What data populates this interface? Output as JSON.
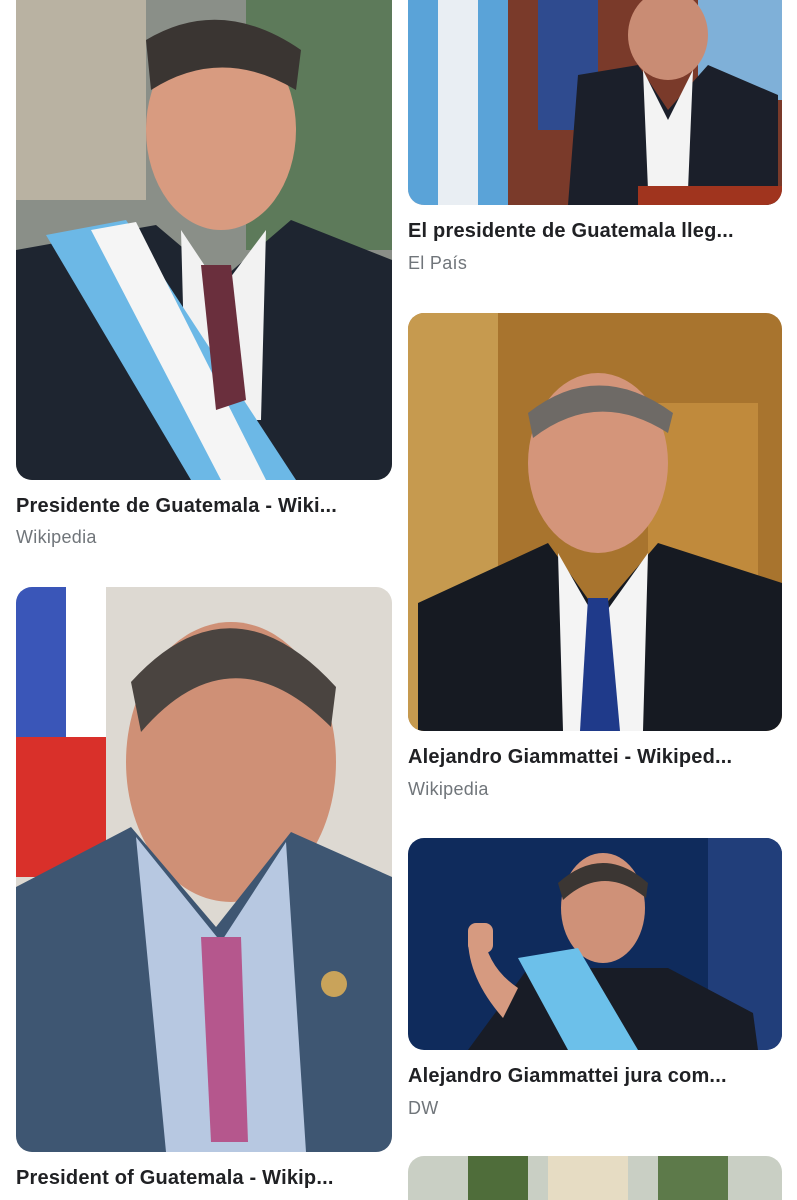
{
  "results": [
    {
      "title": "Presidente de Guatemala - Wiki...",
      "source": "Wikipedia",
      "image": "man-with-presidential-sash-photo"
    },
    {
      "title": "El presidente de Guatemala lleg...",
      "source": "El País",
      "image": "man-speaking-at-podium-with-flags-photo"
    },
    {
      "title": "Alejandro Giammattei - Wikiped...",
      "source": "Wikipedia",
      "image": "official-portrait-photo"
    },
    {
      "title": "President of Guatemala - Wikip...",
      "source": "",
      "image": "portrait-with-flag-photo"
    },
    {
      "title": "Alejandro Giammattei jura com...",
      "source": "DW",
      "image": "man-raising-hand-with-sash-photo"
    },
    {
      "title": "",
      "source": "",
      "image": "partial-image-photo"
    }
  ]
}
